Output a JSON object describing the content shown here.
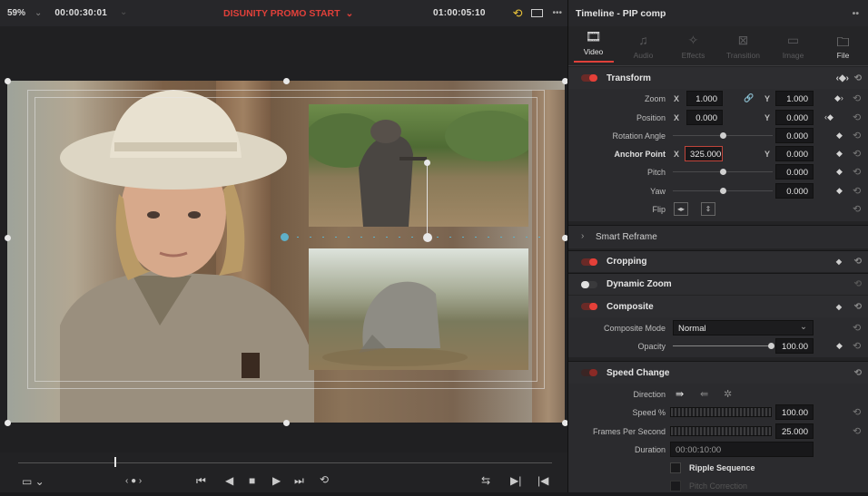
{
  "viewer": {
    "zoom": "59%",
    "source_timecode": "00:00:30:01",
    "clip_name": "DISUNITY PROMO START",
    "record_timecode": "01:00:05:10",
    "playhead_fraction": 0.18
  },
  "inspector": {
    "title": "Timeline - PIP comp",
    "tabs": [
      {
        "label": "Video",
        "icon": "film-icon",
        "active": true
      },
      {
        "label": "Audio",
        "icon": "music-note-icon",
        "active": false
      },
      {
        "label": "Effects",
        "icon": "magic-wand-icon",
        "active": false
      },
      {
        "label": "Transition",
        "icon": "transition-icon",
        "active": false
      },
      {
        "label": "Image",
        "icon": "image-icon",
        "active": false
      },
      {
        "label": "File",
        "icon": "file-icon",
        "active": false
      }
    ],
    "transform": {
      "title": "Transform",
      "zoom_label": "Zoom",
      "zoom_x": "1.000",
      "zoom_y": "1.000",
      "position_label": "Position",
      "position_x": "0.000",
      "position_y": "0.000",
      "rotation_label": "Rotation Angle",
      "rotation": "0.000",
      "anchor_label": "Anchor Point",
      "anchor_x": "325.000",
      "anchor_y": "0.000",
      "pitch_label": "Pitch",
      "pitch": "0.000",
      "yaw_label": "Yaw",
      "yaw": "0.000",
      "flip_label": "Flip",
      "x_label": "X",
      "y_label": "Y"
    },
    "smart_reframe": "Smart Reframe",
    "cropping": "Cropping",
    "dynamic_zoom": "Dynamic Zoom",
    "composite": {
      "title": "Composite",
      "mode_label": "Composite Mode",
      "mode_value": "Normal",
      "opacity_label": "Opacity",
      "opacity": "100.00"
    },
    "speed_change": {
      "title": "Speed Change",
      "direction_label": "Direction",
      "speed_label": "Speed %",
      "speed": "100.00",
      "fps_label": "Frames Per Second",
      "fps": "25.000",
      "duration_label": "Duration",
      "duration": "00:00:10:00",
      "ripple_label": "Ripple Sequence",
      "pitch_correction_label": "Pitch Correction"
    }
  }
}
